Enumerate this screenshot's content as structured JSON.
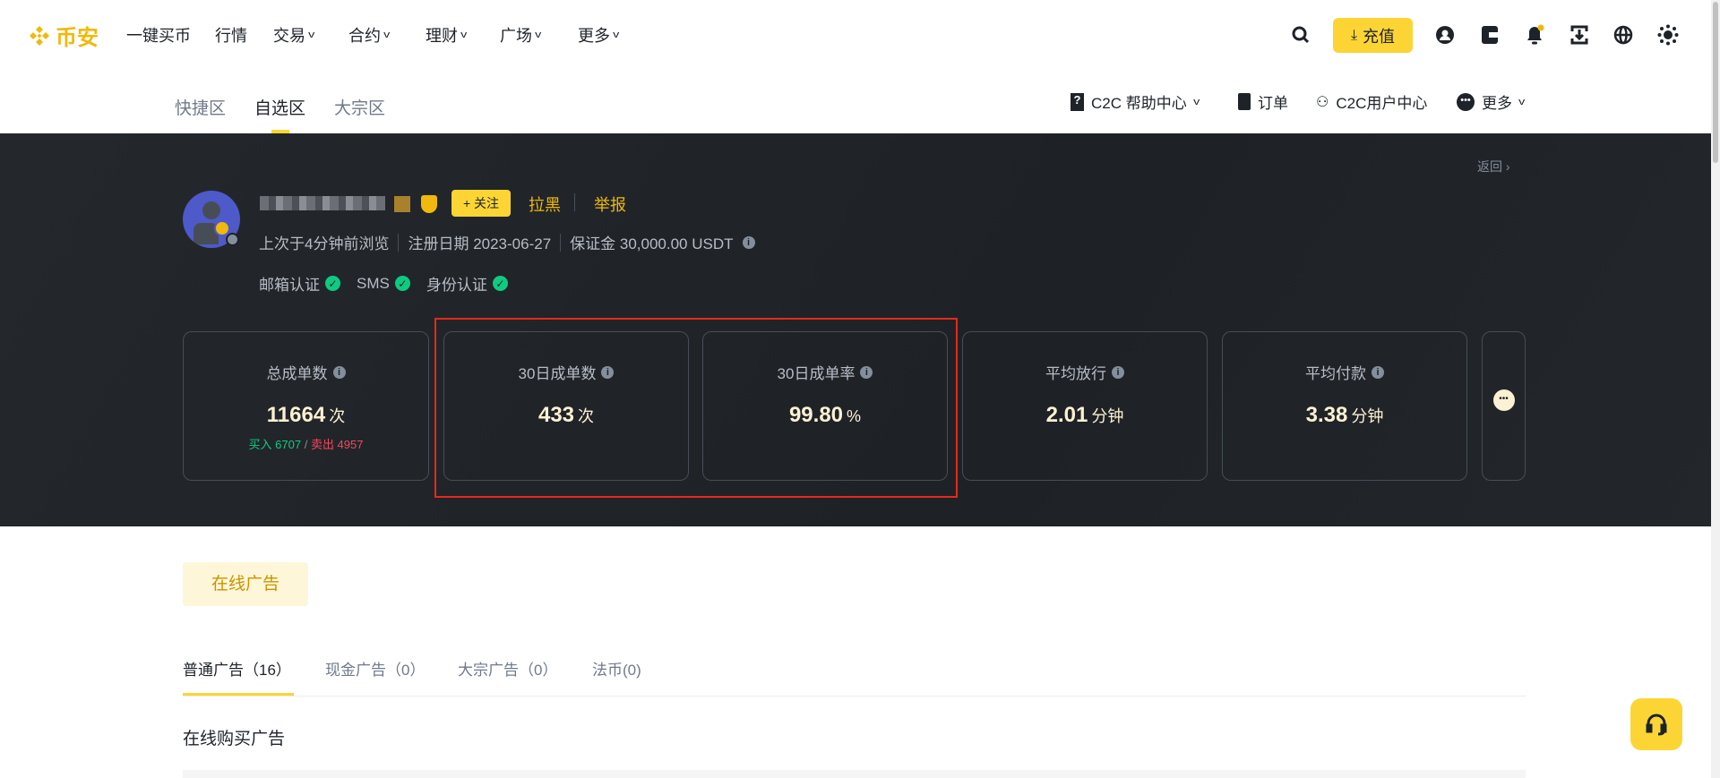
{
  "header": {
    "logo_text": "币安",
    "nav": [
      "一键买币",
      "行情",
      "交易",
      "合约",
      "理财",
      "广场",
      "更多"
    ],
    "deposit_label": "充值",
    "icons": [
      "search-icon",
      "user-icon",
      "wallet-icon",
      "bell-icon",
      "download-icon",
      "globe-icon",
      "theme-icon"
    ]
  },
  "subnav": {
    "tabs": [
      "快捷区",
      "自选区",
      "大宗区"
    ],
    "active": "自选区",
    "right": [
      "C2C 帮助中心",
      "订单",
      "C2C用户中心",
      "更多"
    ]
  },
  "profile": {
    "back_label": "返回",
    "follow_label": "+ 关注",
    "block_label": "拉黑",
    "report_label": "举报",
    "last_seen": "上次于4分钟前浏览",
    "register_date": "注册日期 2023-06-27",
    "deposit": "保证金 30,000.00 USDT",
    "verifications": [
      "邮箱认证",
      "SMS",
      "身份认证"
    ]
  },
  "stats": [
    {
      "label": "总成单数",
      "value": "11664",
      "unit": "次",
      "buy": "买入 6707",
      "sep": "/",
      "sell": "卖出 4957"
    },
    {
      "label": "30日成单数",
      "value": "433",
      "unit": "次"
    },
    {
      "label": "30日成单率",
      "value": "99.80",
      "unit": "%"
    },
    {
      "label": "平均放行",
      "value": "2.01",
      "unit": "分钟"
    },
    {
      "label": "平均付款",
      "value": "3.38",
      "unit": "分钟"
    }
  ],
  "ads": {
    "online_button": "在线广告",
    "tabs": [
      "普通广告（16）",
      "现金广告（0）",
      "大宗广告（0）",
      "法币(0)"
    ],
    "section_title": "在线购买广告"
  },
  "colors": {
    "brand": "#f0b90b",
    "button": "#fcd535",
    "buy": "#0ecb81",
    "sell": "#f6465d",
    "highlight": "#e8281c"
  }
}
